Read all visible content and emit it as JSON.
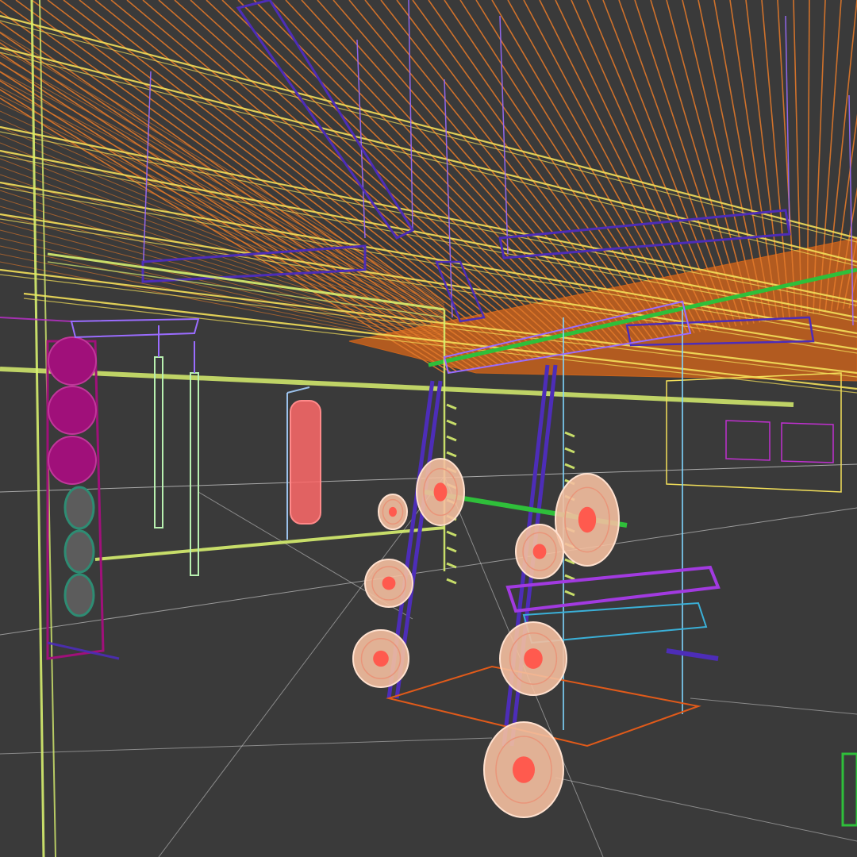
{
  "viewport": {
    "render_mode": "wireframe",
    "colors": {
      "background": "#3a3a3a",
      "ceiling_slats": "#e0782a",
      "ceiling_glow": "#c8621c",
      "beams": "#f3e05a",
      "frame": "#d7ef6f",
      "rack_uprights": "#4d2db8",
      "hangers": "#9a6cff",
      "green_pipe": "#2fbf3a",
      "plates": "#f4bfa0",
      "plate_hub": "#ff5a4e",
      "bench": "#a23ae0",
      "ropes": "#b8f0b0",
      "punching_bag": "#ff6a6a",
      "medicine_balls": "#a0107a",
      "kettlebells": "#2e8c73",
      "floor_grid": "#d9d9d9",
      "walls": "#c030d0"
    },
    "objects": [
      {
        "name": "ceiling-slats-icon"
      },
      {
        "name": "ceiling-beams-icon"
      },
      {
        "name": "hanging-lights-icon"
      },
      {
        "name": "wall-frame-icon"
      },
      {
        "name": "medicine-ball-rack-icon"
      },
      {
        "name": "climbing-ropes-icon"
      },
      {
        "name": "punching-bag-icon"
      },
      {
        "name": "squat-rack-icon"
      },
      {
        "name": "weight-plates-icon"
      },
      {
        "name": "barbell-icon"
      },
      {
        "name": "weight-bench-icon"
      },
      {
        "name": "floor-grid-icon"
      }
    ]
  }
}
